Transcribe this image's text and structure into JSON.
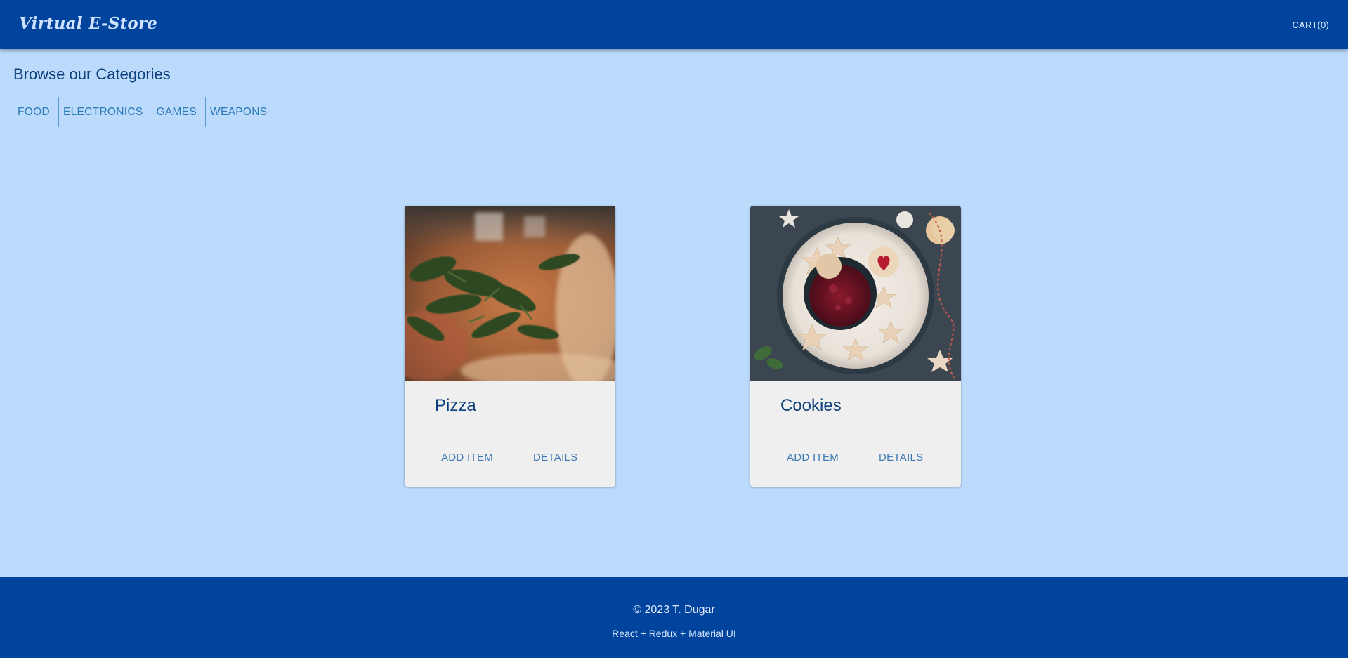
{
  "header": {
    "brand": "Virtual E-Store",
    "cart_label": "CART(0)"
  },
  "categories": {
    "title": "Browse our Categories",
    "items": [
      "FOOD",
      "ELECTRONICS",
      "GAMES",
      "WEAPONS"
    ]
  },
  "products": [
    {
      "name": "Pizza",
      "add_label": "ADD ITEM",
      "details_label": "DETAILS",
      "image": "pizza-photo"
    },
    {
      "name": "Cookies",
      "add_label": "ADD ITEM",
      "details_label": "DETAILS",
      "image": "cookies-photo"
    }
  ],
  "footer": {
    "copyright": "© 2023 T. Dugar",
    "stack": "React + Redux + Material UI"
  },
  "colors": {
    "header_bg": "#00449e",
    "page_bg": "#bbdafc",
    "card_bg": "#efefef",
    "accent_text": "#0c3f7c",
    "button_text": "#3f79b5"
  }
}
